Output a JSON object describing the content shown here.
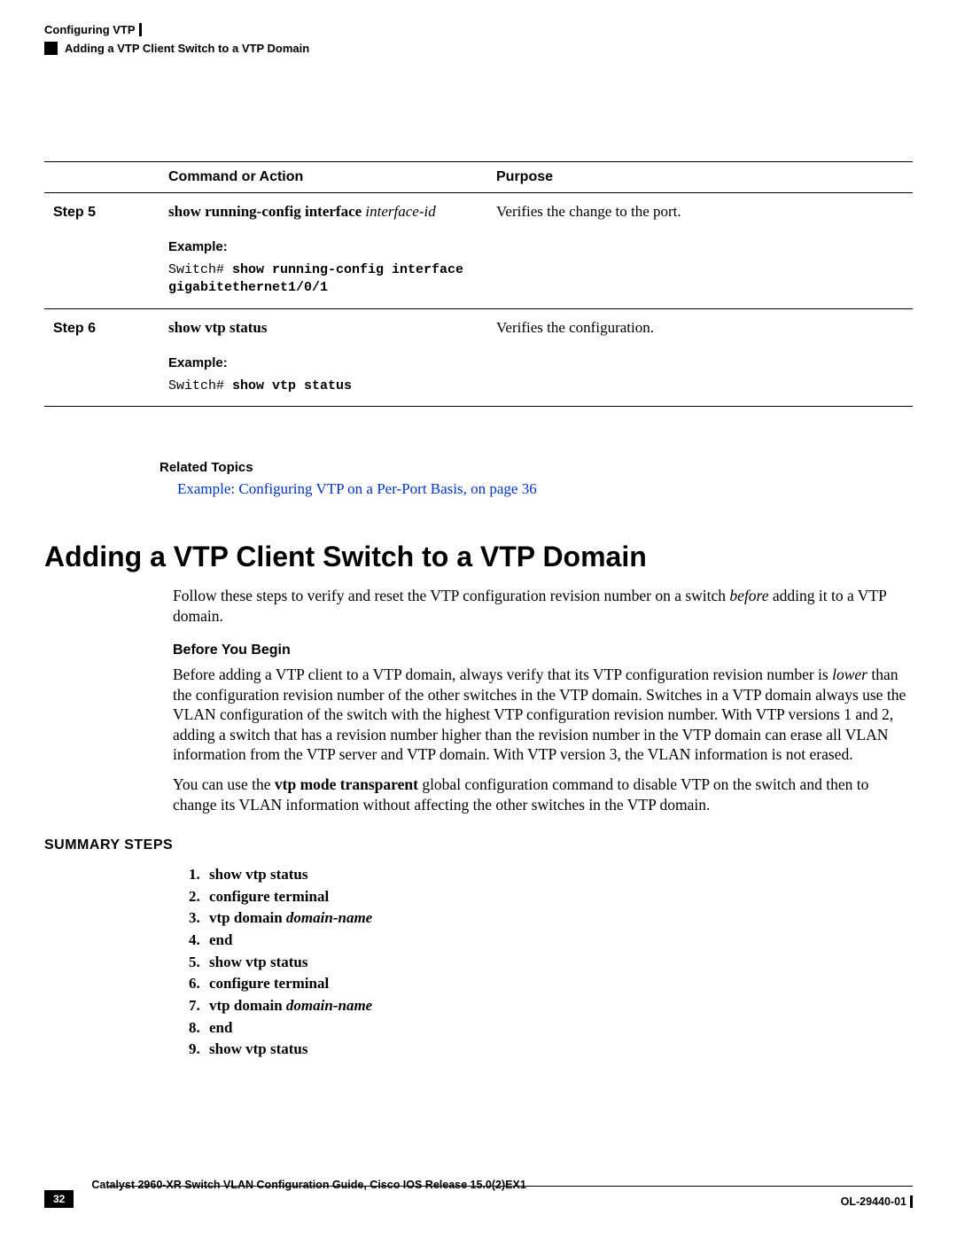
{
  "header": {
    "chapter": "Configuring VTP",
    "section": "Adding a VTP Client Switch to a VTP Domain"
  },
  "table": {
    "headers": {
      "col0": "",
      "col1": "Command or Action",
      "col2": "Purpose"
    },
    "rows": [
      {
        "step": "Step 5",
        "cmd_bold": "show running-config interface",
        "cmd_italic": " interface-id",
        "example_label": "Example:",
        "code_prefix": "Switch# ",
        "code_bold": "show running-config interface\ngigabitethernet1/0/1",
        "purpose": "Verifies the change to the port."
      },
      {
        "step": "Step 6",
        "cmd_bold": "show vtp status",
        "cmd_italic": "",
        "example_label": "Example:",
        "code_prefix": "Switch# ",
        "code_bold": "show vtp status",
        "purpose": "Verifies the configuration."
      }
    ]
  },
  "related": {
    "title": "Related Topics",
    "link": "Example: Configuring VTP on a Per-Port Basis,  on page 36"
  },
  "section": {
    "title": "Adding a VTP Client Switch to a VTP Domain",
    "intro_before": "Follow these steps to verify and reset the VTP configuration revision number on a switch ",
    "intro_italic": "before",
    "intro_after": " adding it to a VTP domain.",
    "before_begin_label": "Before You Begin",
    "bb_p1_a": "Before adding a VTP client to a VTP domain, always verify that its VTP configuration revision number is ",
    "bb_p1_italic": "lower",
    "bb_p1_b": " than the configuration revision number of the other switches in the VTP domain. Switches in a VTP domain always use the VLAN configuration of the switch with the highest VTP configuration revision number. With VTP versions 1 and 2, adding a switch that has a revision number higher than the revision number in the VTP domain can erase all VLAN information from the VTP server and VTP domain. With VTP version 3, the VLAN information is not erased.",
    "bb_p2_a": "You can use the ",
    "bb_p2_bold": "vtp mode transparent",
    "bb_p2_b": " global configuration command to disable VTP on the switch and then to change its VLAN information without affecting the other switches in the VTP domain."
  },
  "summary": {
    "heading": "SUMMARY STEPS",
    "steps": [
      {
        "bold": "show vtp status",
        "italic": ""
      },
      {
        "bold": "configure terminal",
        "italic": ""
      },
      {
        "bold": "vtp domain ",
        "italic": "domain-name"
      },
      {
        "bold": "end",
        "italic": ""
      },
      {
        "bold": "show vtp status",
        "italic": ""
      },
      {
        "bold": "configure terminal",
        "italic": ""
      },
      {
        "bold": "vtp domain ",
        "italic": "domain-name"
      },
      {
        "bold": "end",
        "italic": ""
      },
      {
        "bold": "show vtp status",
        "italic": ""
      }
    ]
  },
  "footer": {
    "page": "32",
    "title": "Catalyst 2960-XR Switch VLAN Configuration Guide, Cisco IOS Release 15.0(2)EX1",
    "docid": "OL-29440-01"
  }
}
